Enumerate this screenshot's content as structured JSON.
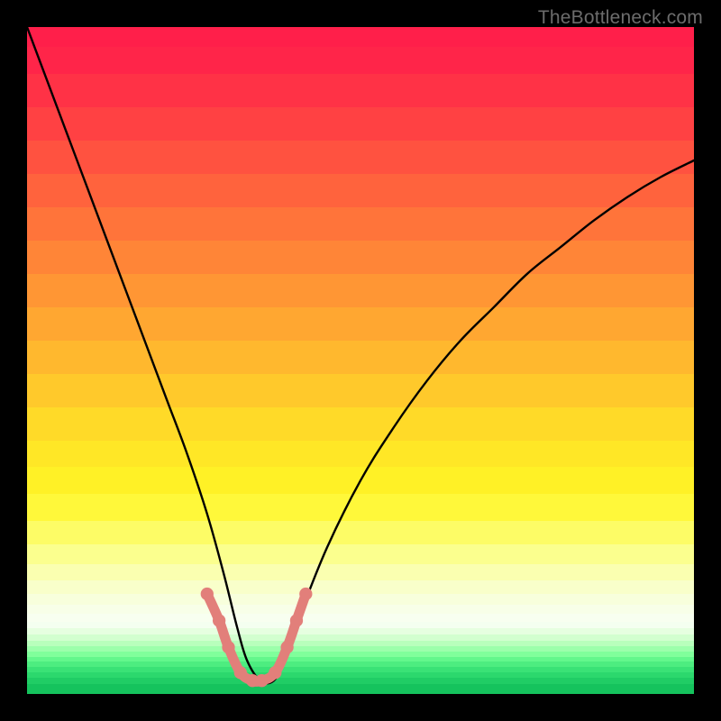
{
  "watermark": "TheBottleneck.com",
  "chart_data": {
    "type": "line",
    "title": "",
    "xlabel": "",
    "ylabel": "",
    "xlim": [
      0,
      100
    ],
    "ylim": [
      0,
      100
    ],
    "series": [
      {
        "name": "bottleneck-curve",
        "x": [
          0,
          3,
          6,
          9,
          12,
          15,
          18,
          21,
          24,
          27,
          29.5,
          31.5,
          33,
          35,
          37,
          38.5,
          41,
          45,
          50,
          55,
          60,
          65,
          70,
          75,
          80,
          85,
          90,
          95,
          100
        ],
        "values": [
          100,
          92,
          84,
          76,
          68,
          60,
          52,
          44,
          36,
          27,
          18,
          10,
          5,
          2,
          2,
          5,
          12,
          22,
          32,
          40,
          47,
          53,
          58,
          63,
          67,
          71,
          74.5,
          77.5,
          80
        ]
      }
    ],
    "gradient_bands": [
      {
        "top_pct": 0.0,
        "height_pct": 3.0,
        "color": "#ff1f4a"
      },
      {
        "top_pct": 3.0,
        "height_pct": 4.0,
        "color": "#ff2549"
      },
      {
        "top_pct": 7.0,
        "height_pct": 5.0,
        "color": "#ff3246"
      },
      {
        "top_pct": 12.0,
        "height_pct": 5.0,
        "color": "#ff4143"
      },
      {
        "top_pct": 17.0,
        "height_pct": 5.0,
        "color": "#ff5240"
      },
      {
        "top_pct": 22.0,
        "height_pct": 5.0,
        "color": "#ff633d"
      },
      {
        "top_pct": 27.0,
        "height_pct": 5.0,
        "color": "#ff743a"
      },
      {
        "top_pct": 32.0,
        "height_pct": 5.0,
        "color": "#ff8537"
      },
      {
        "top_pct": 37.0,
        "height_pct": 5.0,
        "color": "#ff9634"
      },
      {
        "top_pct": 42.0,
        "height_pct": 5.0,
        "color": "#ffa731"
      },
      {
        "top_pct": 47.0,
        "height_pct": 5.0,
        "color": "#ffb82e"
      },
      {
        "top_pct": 52.0,
        "height_pct": 5.0,
        "color": "#ffc92b"
      },
      {
        "top_pct": 57.0,
        "height_pct": 5.0,
        "color": "#ffda28"
      },
      {
        "top_pct": 62.0,
        "height_pct": 4.0,
        "color": "#ffe726"
      },
      {
        "top_pct": 66.0,
        "height_pct": 4.0,
        "color": "#fff126"
      },
      {
        "top_pct": 70.0,
        "height_pct": 4.0,
        "color": "#fff83a"
      },
      {
        "top_pct": 74.0,
        "height_pct": 3.5,
        "color": "#fdfc66"
      },
      {
        "top_pct": 77.5,
        "height_pct": 3.0,
        "color": "#fbff8e"
      },
      {
        "top_pct": 80.5,
        "height_pct": 2.5,
        "color": "#faffb0"
      },
      {
        "top_pct": 83.0,
        "height_pct": 2.0,
        "color": "#f9ffca"
      },
      {
        "top_pct": 85.0,
        "height_pct": 1.6,
        "color": "#f8ffdc"
      },
      {
        "top_pct": 86.6,
        "height_pct": 1.4,
        "color": "#f8ffe8"
      },
      {
        "top_pct": 88.0,
        "height_pct": 1.2,
        "color": "#f8fff0"
      },
      {
        "top_pct": 89.2,
        "height_pct": 1.0,
        "color": "#f4fff0"
      },
      {
        "top_pct": 90.2,
        "height_pct": 0.9,
        "color": "#e6ffe0"
      },
      {
        "top_pct": 91.1,
        "height_pct": 0.9,
        "color": "#d2ffcf"
      },
      {
        "top_pct": 92.0,
        "height_pct": 0.8,
        "color": "#b8ffbc"
      },
      {
        "top_pct": 92.8,
        "height_pct": 0.8,
        "color": "#9cffab"
      },
      {
        "top_pct": 93.6,
        "height_pct": 0.8,
        "color": "#80ff9b"
      },
      {
        "top_pct": 94.4,
        "height_pct": 0.8,
        "color": "#63f78c"
      },
      {
        "top_pct": 95.2,
        "height_pct": 0.8,
        "color": "#4ded80"
      },
      {
        "top_pct": 96.0,
        "height_pct": 0.8,
        "color": "#3ae276"
      },
      {
        "top_pct": 96.8,
        "height_pct": 0.8,
        "color": "#2cd86d"
      },
      {
        "top_pct": 97.6,
        "height_pct": 0.9,
        "color": "#20cd65"
      },
      {
        "top_pct": 98.5,
        "height_pct": 1.5,
        "color": "#15c35d"
      }
    ],
    "valley_marker": {
      "color": "#e27f7a",
      "stroke_width": 11,
      "points_xy": [
        [
          27.0,
          15.0
        ],
        [
          28.8,
          11.0
        ],
        [
          30.2,
          7.0
        ],
        [
          32.0,
          3.2
        ],
        [
          33.8,
          2.0
        ],
        [
          35.2,
          2.0
        ],
        [
          37.2,
          3.2
        ],
        [
          39.0,
          7.0
        ],
        [
          40.4,
          11.0
        ],
        [
          41.8,
          15.0
        ]
      ]
    }
  }
}
